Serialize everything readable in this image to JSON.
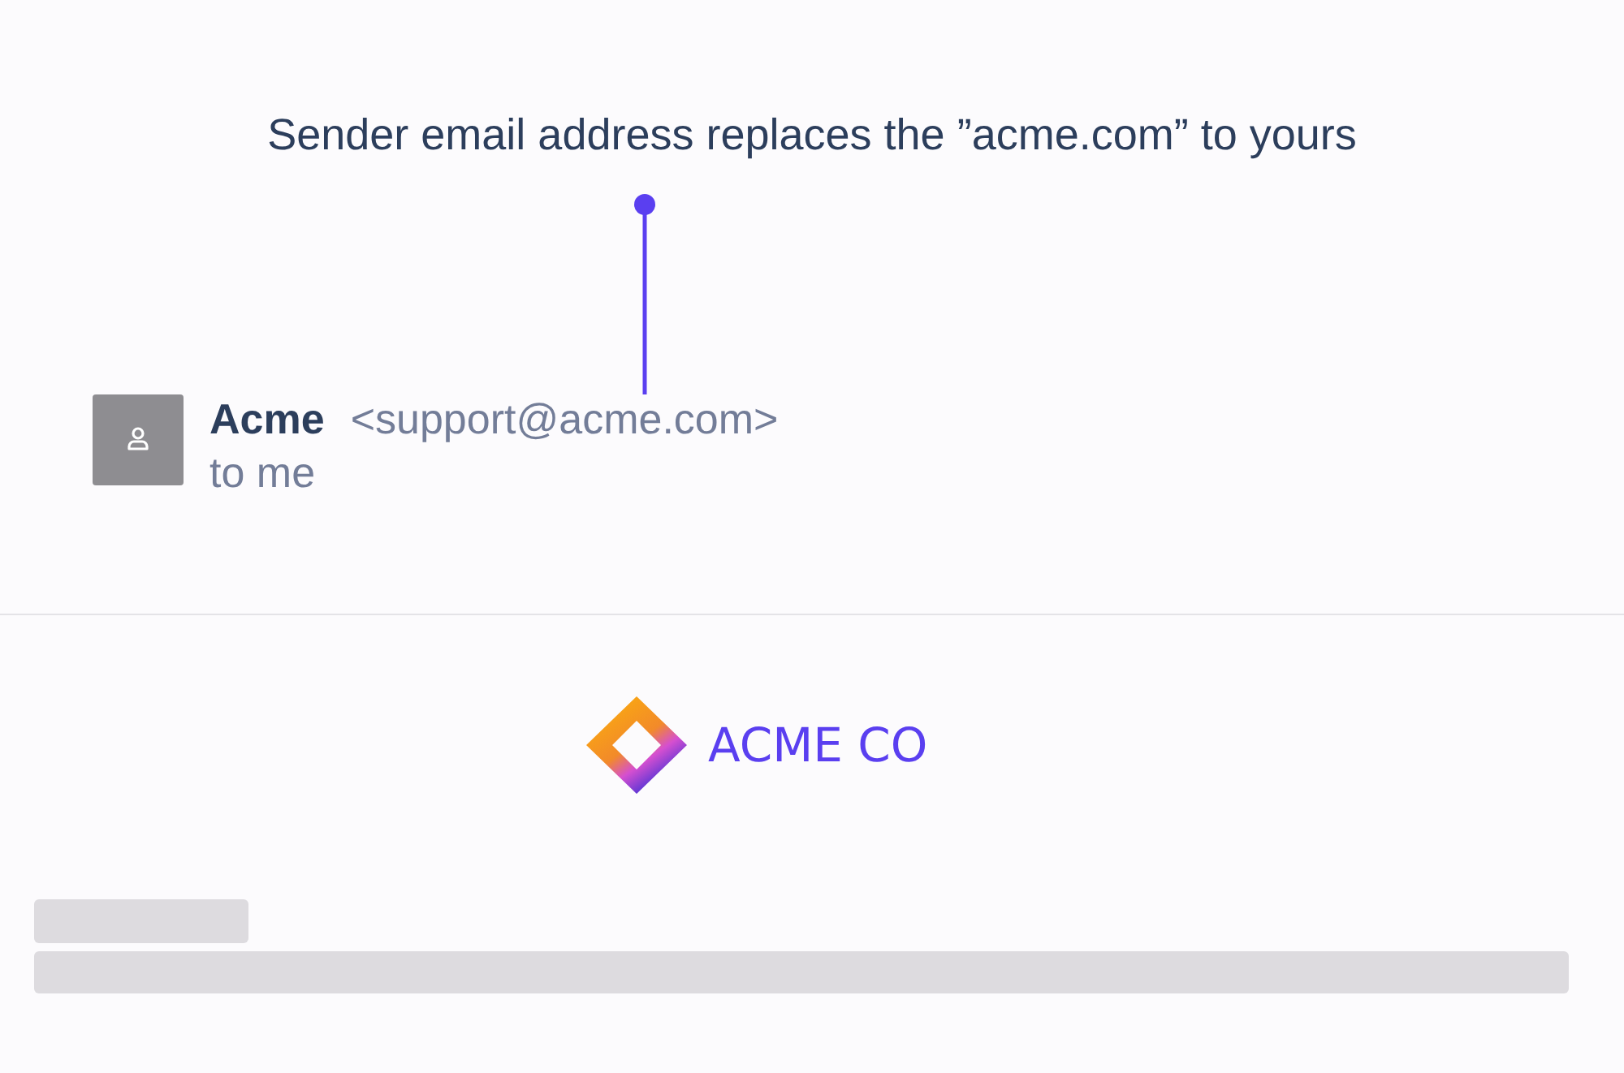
{
  "annotation": {
    "text": "Sender email address replaces the ”acme.com” to yours"
  },
  "email_header": {
    "sender_name": "Acme",
    "sender_address": "<support@acme.com>",
    "recipient": "to me"
  },
  "email_body": {
    "logo_text": "ACME CO"
  }
}
